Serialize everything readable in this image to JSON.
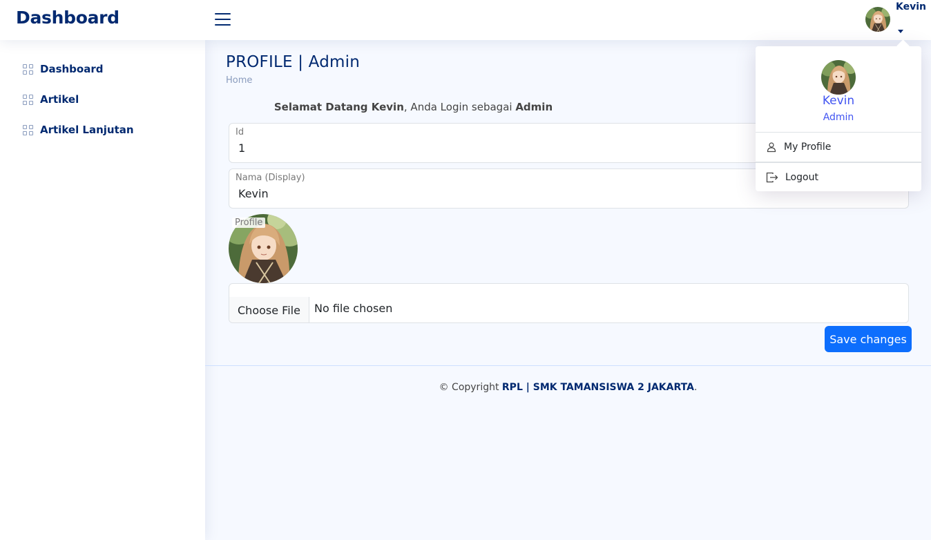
{
  "header": {
    "logo": "Dashboard",
    "username": "Kevin"
  },
  "sidebar": {
    "items": [
      {
        "label": "Dashboard",
        "icon": "grid-icon"
      },
      {
        "label": "Artikel",
        "icon": "grid-icon"
      },
      {
        "label": "Artikel Lanjutan",
        "icon": "grid-icon"
      }
    ]
  },
  "main": {
    "title": "PROFILE | Admin",
    "breadcrumb": "Home",
    "welcome": {
      "prefix": "Selamat Datang Kevin",
      "middle": ", Anda Login sebagai ",
      "role": "Admin"
    },
    "fields": {
      "id_label": "Id",
      "id_value": "1",
      "name_label": "Nama (Display)",
      "name_value": "Kevin",
      "profile_label": "Profile"
    },
    "file": {
      "button": "Choose File",
      "status": "No file chosen"
    },
    "save_label": "Save changes"
  },
  "footer": {
    "prefix": "© Copyright ",
    "brand": "RPL | SMK TAMANSISWA 2 JAKARTA",
    "suffix": "."
  },
  "dropdown": {
    "name": "Kevin",
    "role": "Admin",
    "my_profile": "My Profile",
    "logout": "Logout"
  },
  "colors": {
    "brand": "#012970",
    "accent": "#4154f1",
    "primary_button": "#0d6efd",
    "background": "#f6f9ff"
  }
}
